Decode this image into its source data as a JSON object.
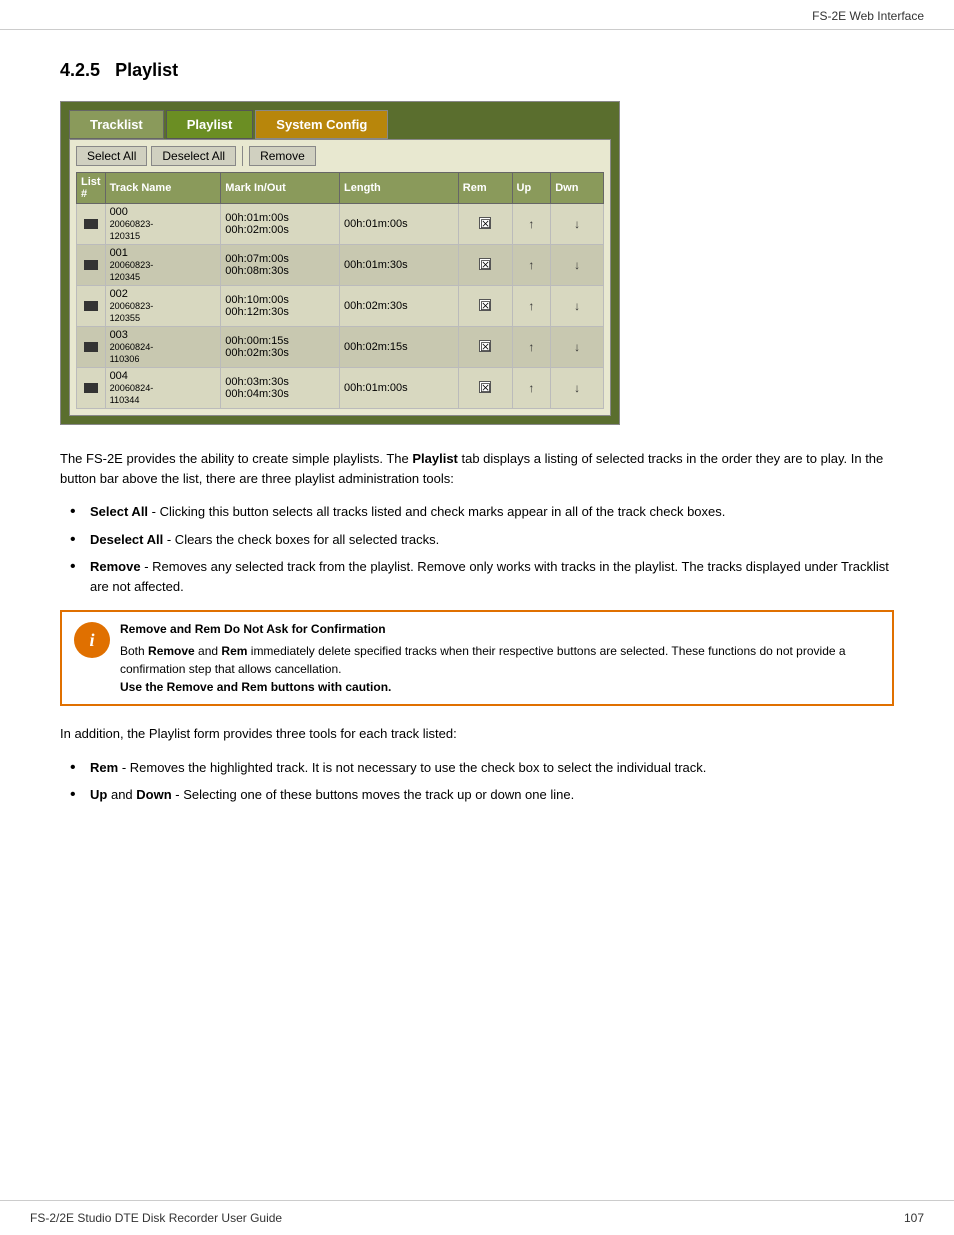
{
  "header": {
    "title": "FS-2E Web Interface"
  },
  "section": {
    "number": "4.2.5",
    "title": "Playlist"
  },
  "ui": {
    "tabs": [
      {
        "label": "Tracklist",
        "active": false
      },
      {
        "label": "Playlist",
        "active": true
      },
      {
        "label": "System Config",
        "active": false
      }
    ],
    "buttons": [
      {
        "label": "Select All"
      },
      {
        "label": "Deselect All"
      },
      {
        "label": "Remove"
      }
    ],
    "table": {
      "columns": [
        "List #",
        "Track Name",
        "Mark In/Out",
        "Length",
        "Rem",
        "Up",
        "Dwn"
      ],
      "rows": [
        {
          "num": "000",
          "name": "20060823-\n120315",
          "mark": "00h:01m:00s\n00h:02m:00s",
          "length": "00h:01m:00s",
          "rem": true,
          "checked": true
        },
        {
          "num": "001",
          "name": "20060823-\n120345",
          "mark": "00h:07m:00s\n00h:08m:30s",
          "length": "00h:01m:30s",
          "rem": true,
          "checked": true
        },
        {
          "num": "002",
          "name": "20060823-\n120355",
          "mark": "00h:10m:00s\n00h:12m:30s",
          "length": "00h:02m:30s",
          "rem": true,
          "checked": true
        },
        {
          "num": "003",
          "name": "20060824-\n110306",
          "mark": "00h:00m:15s\n00h:02m:30s",
          "length": "00h:02m:15s",
          "rem": true,
          "checked": true
        },
        {
          "num": "004",
          "name": "20060824-\n110344",
          "mark": "00h:03m:30s\n00h:04m:30s",
          "length": "00h:01m:00s",
          "rem": true,
          "checked": true
        }
      ]
    }
  },
  "body": {
    "intro": "The FS-2E provides the ability to create simple playlists. The Playlist tab displays a listing of selected tracks in the order they are to play. In the button bar above the list, there are three playlist administration tools:",
    "intro_bold_word": "Playlist",
    "bullets_section1": [
      {
        "bold": "Select All",
        "text": " - Clicking this button selects all tracks listed and check marks appear in all of the track check boxes."
      },
      {
        "bold": "Deselect All",
        "text": " - Clears the check boxes for all selected tracks."
      },
      {
        "bold": "Remove",
        "text": " - Removes any selected track from the playlist. Remove only works with tracks in the playlist. The tracks displayed under Tracklist are not affected."
      }
    ],
    "note": {
      "icon_label": "i",
      "title": "Remove and Rem Do Not Ask for Confirmation",
      "lines": [
        "Both Remove and Rem immediately delete specified tracks when their respective buttons are selected. These functions do not provide a confirmation step that allows cancellation.",
        "Use the Remove and Rem buttons with caution."
      ],
      "bold_words": [
        "Remove",
        "Rem",
        "Remove",
        "Rem",
        "Use the Remove and Rem buttons with caution."
      ]
    },
    "intro2": "In addition, the Playlist form provides three tools for each track listed:",
    "bullets_section2": [
      {
        "bold": "Rem",
        "text": " - Removes the highlighted track. It is not necessary to use the check box to select the individual track."
      },
      {
        "bold": "Up",
        "text": " and ",
        "bold2": "Down",
        "text2": " - Selecting one of these buttons moves the track up or down one line."
      }
    ]
  },
  "footer": {
    "title": "FS-2/2E Studio DTE Disk Recorder User Guide",
    "page": "107"
  }
}
